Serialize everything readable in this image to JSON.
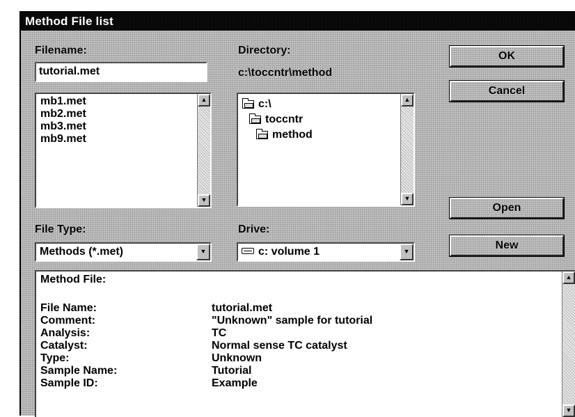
{
  "window": {
    "title": "Method File list"
  },
  "filename": {
    "label": "Filename:",
    "value": "tutorial.met",
    "files": [
      "mb1.met",
      "mb2.met",
      "mb3.met",
      "mb9.met"
    ]
  },
  "directory": {
    "label": "Directory:",
    "path": "c:\\toccntr\\method",
    "folders": [
      "c:\\",
      "toccntr",
      "method"
    ]
  },
  "file_type": {
    "label": "File Type:",
    "selected": "Methods (*.met)"
  },
  "drive": {
    "label": "Drive:",
    "selected": "c: volume 1"
  },
  "buttons": {
    "ok": "OK",
    "cancel": "Cancel",
    "open": "Open",
    "new": "New"
  },
  "info": {
    "heading": "Method File:",
    "rows": [
      {
        "key": "File Name:",
        "value": "tutorial.met"
      },
      {
        "key": "Comment:",
        "value": "\"Unknown\" sample for tutorial"
      },
      {
        "key": "Analysis:",
        "value": "TC"
      },
      {
        "key": "Catalyst:",
        "value": "Normal sense TC catalyst"
      },
      {
        "key": "Type:",
        "value": "Unknown"
      },
      {
        "key": "Sample Name:",
        "value": "Tutorial"
      },
      {
        "key": "Sample ID:",
        "value": "Example"
      }
    ]
  }
}
